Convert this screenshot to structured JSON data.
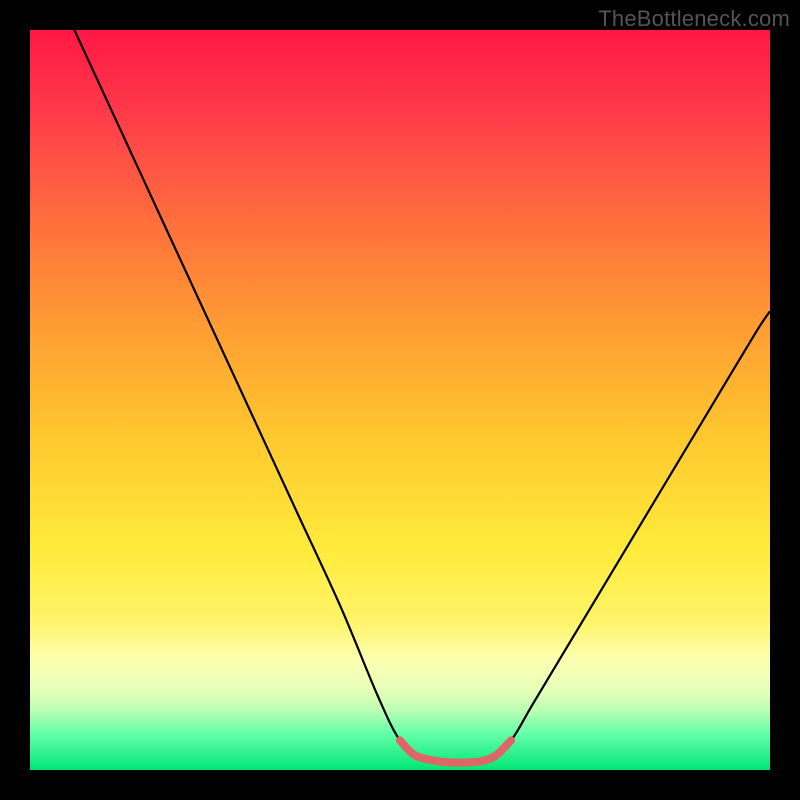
{
  "watermark": "TheBottleneck.com",
  "chart_data": {
    "type": "line",
    "title": "",
    "xlabel": "",
    "ylabel": "",
    "xlim": [
      0,
      100
    ],
    "ylim": [
      0,
      100
    ],
    "grid": false,
    "legend": false,
    "background": {
      "vertical_gradient_stops": [
        {
          "pct": 0,
          "color": "#ff1744"
        },
        {
          "pct": 12,
          "color": "#ff3d4a"
        },
        {
          "pct": 26,
          "color": "#ff6f3c"
        },
        {
          "pct": 40,
          "color": "#ff9c33"
        },
        {
          "pct": 55,
          "color": "#ffc82e"
        },
        {
          "pct": 70,
          "color": "#ffeb3b"
        },
        {
          "pct": 80,
          "color": "#fff46a"
        },
        {
          "pct": 85,
          "color": "#fdffb0"
        },
        {
          "pct": 89,
          "color": "#e8ffb8"
        },
        {
          "pct": 92,
          "color": "#b9ffb3"
        },
        {
          "pct": 95,
          "color": "#66ffaa"
        },
        {
          "pct": 100,
          "color": "#00e676"
        }
      ]
    },
    "series": [
      {
        "name": "black-curve",
        "color": "#000000",
        "width": 2.2,
        "points": [
          {
            "x": 6,
            "y": 100
          },
          {
            "x": 12,
            "y": 87
          },
          {
            "x": 18,
            "y": 74
          },
          {
            "x": 24,
            "y": 61
          },
          {
            "x": 30,
            "y": 48
          },
          {
            "x": 36,
            "y": 35
          },
          {
            "x": 42,
            "y": 22
          },
          {
            "x": 47,
            "y": 10
          },
          {
            "x": 50,
            "y": 4
          },
          {
            "x": 53,
            "y": 1.5
          },
          {
            "x": 56,
            "y": 1
          },
          {
            "x": 59,
            "y": 1
          },
          {
            "x": 62,
            "y": 1.5
          },
          {
            "x": 65,
            "y": 4
          },
          {
            "x": 68,
            "y": 9
          },
          {
            "x": 74,
            "y": 19
          },
          {
            "x": 80,
            "y": 29
          },
          {
            "x": 86,
            "y": 39
          },
          {
            "x": 92,
            "y": 49
          },
          {
            "x": 98,
            "y": 59
          },
          {
            "x": 100,
            "y": 62
          }
        ]
      },
      {
        "name": "bottom-highlight",
        "color": "#e06666",
        "width": 8,
        "linecap": "round",
        "points": [
          {
            "x": 50,
            "y": 4
          },
          {
            "x": 52,
            "y": 2
          },
          {
            "x": 55,
            "y": 1.2
          },
          {
            "x": 58,
            "y": 1
          },
          {
            "x": 61,
            "y": 1.2
          },
          {
            "x": 63,
            "y": 2
          },
          {
            "x": 65,
            "y": 4
          }
        ]
      }
    ]
  }
}
